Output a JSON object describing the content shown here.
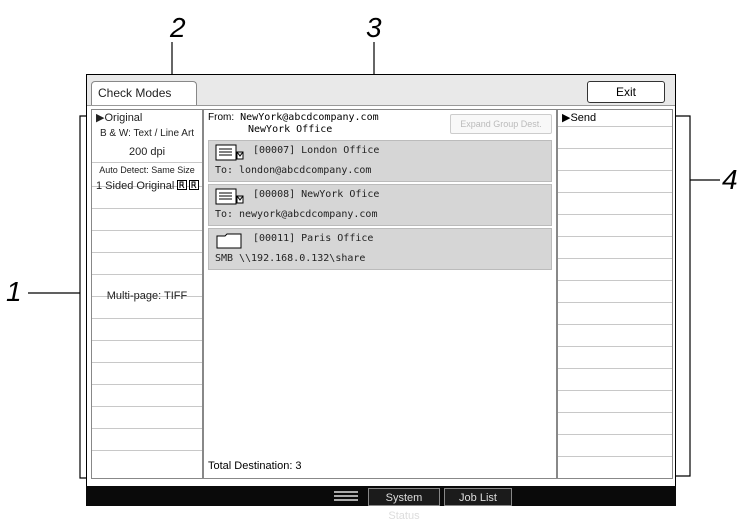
{
  "callouts": {
    "c1": "1",
    "c2": "2",
    "c3": "3",
    "c4": "4"
  },
  "window": {
    "title": "Check Modes",
    "exit_label": "Exit"
  },
  "left_panel": {
    "header": "Original",
    "items": [
      "B & W: Text / Line Art",
      "200 dpi",
      "Auto Detect: Same Size",
      "1 Sided Original"
    ],
    "file_type": "Multi-page: TIFF"
  },
  "middle_panel": {
    "from_label": "From:",
    "from_email": "NewYork@abcdcompany.com",
    "from_name": "NewYork Office",
    "expand_group_label": "Expand Group Dest.",
    "destinations": [
      {
        "icon": "email-icon",
        "line1": "[00007] London Office",
        "prefix": "To:",
        "address": "london@abcdcompany.com"
      },
      {
        "icon": "email-icon",
        "line1": "[00008] NewYork Ofice",
        "prefix": "To:",
        "address": "newyork@abcdcompany.com"
      },
      {
        "icon": "folder-icon",
        "line1": "[00011] Paris Office",
        "prefix": "SMB",
        "address": "\\\\192.168.0.132\\share"
      }
    ],
    "total_label": "Total Destination: 3"
  },
  "right_panel": {
    "header": "Send"
  },
  "status_bar": {
    "system_status_label": "System Status",
    "job_list_label": "Job List"
  }
}
